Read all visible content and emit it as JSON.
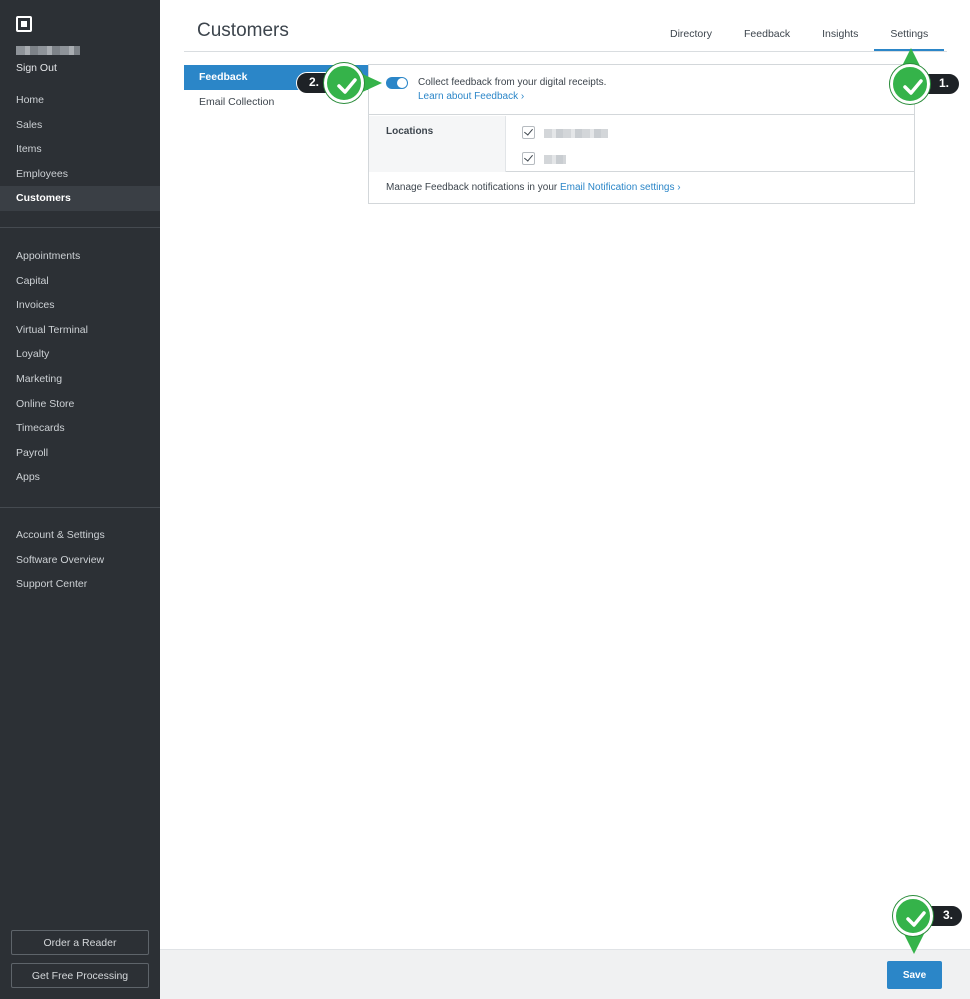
{
  "sidebar": {
    "sign_out": "Sign Out",
    "primary_items": [
      {
        "label": "Home"
      },
      {
        "label": "Sales"
      },
      {
        "label": "Items"
      },
      {
        "label": "Employees"
      },
      {
        "label": "Customers",
        "active": true
      }
    ],
    "secondary_items": [
      {
        "label": "Appointments"
      },
      {
        "label": "Capital"
      },
      {
        "label": "Invoices"
      },
      {
        "label": "Virtual Terminal"
      },
      {
        "label": "Loyalty"
      },
      {
        "label": "Marketing"
      },
      {
        "label": "Online Store"
      },
      {
        "label": "Timecards"
      },
      {
        "label": "Payroll"
      },
      {
        "label": "Apps"
      }
    ],
    "tertiary_items": [
      {
        "label": "Account & Settings"
      },
      {
        "label": "Software Overview"
      },
      {
        "label": "Support Center"
      }
    ],
    "order_reader": "Order a Reader",
    "free_processing": "Get Free Processing"
  },
  "header": {
    "title": "Customers",
    "tabs": [
      {
        "label": "Directory"
      },
      {
        "label": "Feedback"
      },
      {
        "label": "Insights"
      },
      {
        "label": "Settings",
        "active": true
      }
    ]
  },
  "subnav": {
    "items": [
      {
        "label": "Feedback",
        "active": true
      },
      {
        "label": "Email Collection"
      }
    ]
  },
  "feedback_panel": {
    "toggle_on": true,
    "collect_text": "Collect feedback from your digital receipts.",
    "learn_link": "Learn about Feedback ›",
    "locations_label": "Locations",
    "locations_checked": [
      true,
      true
    ],
    "manage_text": "Manage Feedback notifications in your ",
    "notification_link": "Email Notification settings ›"
  },
  "footer": {
    "save": "Save"
  },
  "annotations": {
    "step1": "1.",
    "step2": "2.",
    "step3": "3."
  },
  "colors": {
    "accent": "#2b86c8",
    "sidebar_bg": "#2c3035",
    "marker_green": "#35b34a"
  }
}
